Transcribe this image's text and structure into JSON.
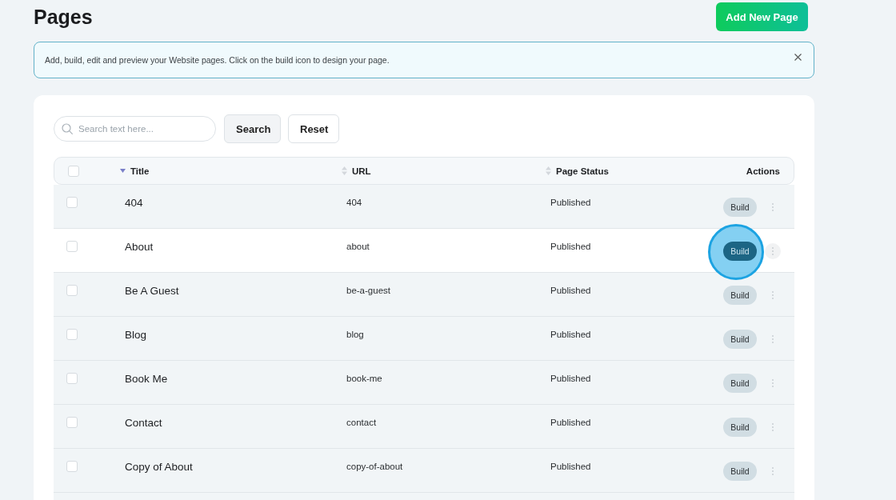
{
  "page": {
    "title": "Pages",
    "add_button": "Add New Page"
  },
  "notice": {
    "text": "Add, build, edit and preview your Website pages. Click on the build icon to design your page."
  },
  "toolbar": {
    "search": {
      "placeholder": "Search text here..."
    },
    "buttons": [
      {
        "label": "Search",
        "kind": "primary"
      },
      {
        "label": "Reset",
        "kind": "secondary"
      }
    ]
  },
  "table": {
    "select_all": {
      "checked": false
    },
    "columns": [
      {
        "label": "Title",
        "sorted": true
      },
      {
        "label": "URL",
        "sorted": false
      },
      {
        "label": "Page Status",
        "sorted": false
      },
      {
        "label": "Actions"
      }
    ],
    "rows": [
      {
        "checked": false,
        "title": "404",
        "url": "404",
        "status": "Published",
        "action": "Build",
        "highlighted": false
      },
      {
        "checked": false,
        "title": "About",
        "url": "about",
        "status": "Published",
        "action": "Build",
        "highlighted": true
      },
      {
        "checked": false,
        "title": "Be A Guest",
        "url": "be-a-guest",
        "status": "Published",
        "action": "Build",
        "highlighted": false
      },
      {
        "checked": false,
        "title": "Blog",
        "url": "blog",
        "status": "Published",
        "action": "Build",
        "highlighted": false
      },
      {
        "checked": false,
        "title": "Book Me",
        "url": "book-me",
        "status": "Published",
        "action": "Build",
        "highlighted": false
      },
      {
        "checked": false,
        "title": "Contact",
        "url": "contact",
        "status": "Published",
        "action": "Build",
        "highlighted": false
      },
      {
        "checked": false,
        "title": "Copy of About",
        "url": "copy-of-about",
        "status": "Published",
        "action": "Build",
        "highlighted": false
      }
    ]
  }
}
